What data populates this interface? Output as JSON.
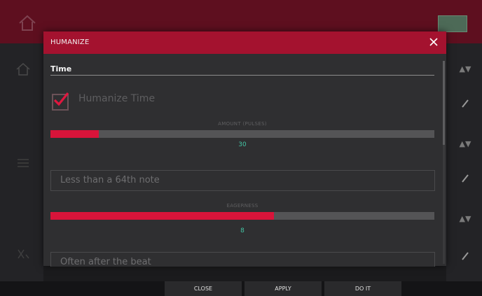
{
  "dialog": {
    "title": "HUMANIZE",
    "section": "Time",
    "humanize_time": {
      "label": "Humanize Time",
      "checked": true
    },
    "amount_slider": {
      "label": "AMOUNT (PULSES)",
      "value": "30",
      "fill_fraction": 0.125
    },
    "dropdown1": {
      "value": "Less than a 64th note"
    },
    "eagerness_slider": {
      "label": "EAGERNESS",
      "value": "8",
      "fill_fraction": 0.583
    },
    "dropdown2": {
      "value": "Often after the beat"
    }
  },
  "buttons": {
    "close": "CLOSE",
    "apply": "APPLY",
    "do_it": "DO IT"
  },
  "colors": {
    "accent": "#d8143a",
    "header": "#a4122f",
    "value": "#44c7a6"
  }
}
